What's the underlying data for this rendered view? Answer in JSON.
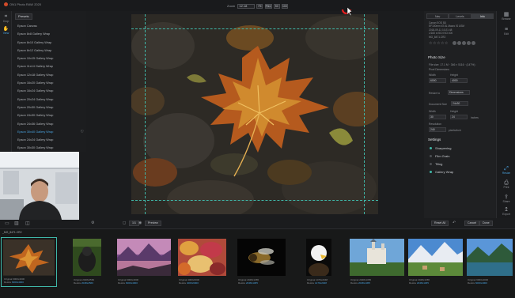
{
  "app": {
    "title": "ON1 Photo RAW 2020"
  },
  "zoom": {
    "label": "Zoom",
    "value": "12.18",
    "buttons": [
      "Fit",
      "FILL",
      "50",
      "100"
    ]
  },
  "left_tools": [
    {
      "label": "Crop",
      "icon": "crop-icon"
    },
    {
      "label": "View",
      "icon": "hand-icon"
    }
  ],
  "presets": {
    "header": "Presets",
    "items": [
      "Epson Canvas",
      "Epson 8x8 Gallery Wrap",
      "Epson 8x10 Gallery Wrap",
      "Epson 8x12 Gallery Wrap",
      "Epson 10x15 Gallery Wrap",
      "Epson 11x14 Gallery Wrap",
      "Epson 12x18 Gallery Wrap",
      "Epson 16x20 Gallery Wrap",
      "Epson 16x24 Gallery Wrap",
      "Epson 20x24 Gallery Wrap",
      "Epson 20x30 Gallery Wrap",
      "Epson 24x30 Gallery Wrap",
      "Epson 24x36 Gallery Wrap",
      "Epson 30x40 Gallery Wrap",
      "Epson 24x24 Gallery Wrap",
      "Epson 30x30 Gallery Wrap"
    ]
  },
  "right_panel": {
    "tabs": [
      "Nav",
      "Levels",
      "Info"
    ],
    "meta": [
      "Canon EOS 5D",
      "EF100mm f/2.8L Macro IS USM",
      "2018-09-11 10:21:48",
      "1/160 s   f/8.0   ISO 400",
      "MG_8471.CR2"
    ],
    "stars": "☆☆☆☆☆",
    "photo_size": {
      "title": "Photo Size",
      "file_size": "File size: 17.1 M · 346 × 5116 · (147%)",
      "pixel_dimensions": "Pixel Dimensions",
      "width_label": "Width",
      "width_value": "6000",
      "height_label": "Height",
      "height_value": "4000",
      "resize_label": "Resize to",
      "resize_value": "Dimensions",
      "document_size": "Document Size",
      "document_value": "24x30",
      "doc_width_label": "Width",
      "doc_width_value": "30",
      "doc_height_label": "Height",
      "doc_height_value": "24",
      "units": "inches",
      "resolution_label": "Resolution",
      "resolution_value": "240",
      "resolution_units": "pixels/inch"
    },
    "settings": {
      "title": "Settings",
      "items": [
        {
          "label": "Sharpening",
          "on": true
        },
        {
          "label": "Film Grain",
          "on": false
        },
        {
          "label": "Tiling",
          "on": false
        },
        {
          "label": "Gallery Wrap",
          "on": true
        }
      ]
    }
  },
  "right_icons": [
    {
      "label": "Browse",
      "icon": "grid-icon"
    },
    {
      "label": "Edit",
      "icon": "sliders-icon"
    },
    {
      "label": "Resize",
      "icon": "resize-icon"
    },
    {
      "label": "Print",
      "icon": "printer-icon"
    },
    {
      "label": "Share",
      "icon": "share-icon"
    },
    {
      "label": "Export",
      "icon": "export-icon"
    }
  ],
  "bottom_bar": {
    "preview_label": "Preview",
    "reset_all": "Reset All",
    "cancel": "Cancel",
    "done": "Done",
    "page_num": "1/1"
  },
  "filmstrip": {
    "filename": "_MG_8471.CR2",
    "thumbs": [
      {
        "l1": "Original",
        "v1": "6000x4000",
        "l2": "Resize",
        "v2": "6000x4000"
      },
      {
        "l1": "Original",
        "v1": "2048x2560",
        "l2": "Resize",
        "v2": "2048x2560"
      },
      {
        "l1": "Original",
        "v1": "6000x4000",
        "l2": "Resize",
        "v2": "6000x4000"
      },
      {
        "l1": "Original",
        "v1": "4000x6000",
        "l2": "Resize",
        "v2": "4000x6000"
      },
      {
        "l1": "Original",
        "v1": "2048x1365",
        "l2": "Resize",
        "v2": "2048x1365"
      },
      {
        "l1": "Original",
        "v1": "1479x2048",
        "l2": "Resize",
        "v2": "1479x2048"
      },
      {
        "l1": "Original",
        "v1": "2048x1365",
        "l2": "Resize",
        "v2": "2048x1365"
      },
      {
        "l1": "Original",
        "v1": "2048x1365",
        "l2": "Resize",
        "v2": "2048x1365"
      },
      {
        "l1": "Original",
        "v1": "6000x4000",
        "l2": "Resize",
        "v2": "6000x4000"
      }
    ]
  }
}
